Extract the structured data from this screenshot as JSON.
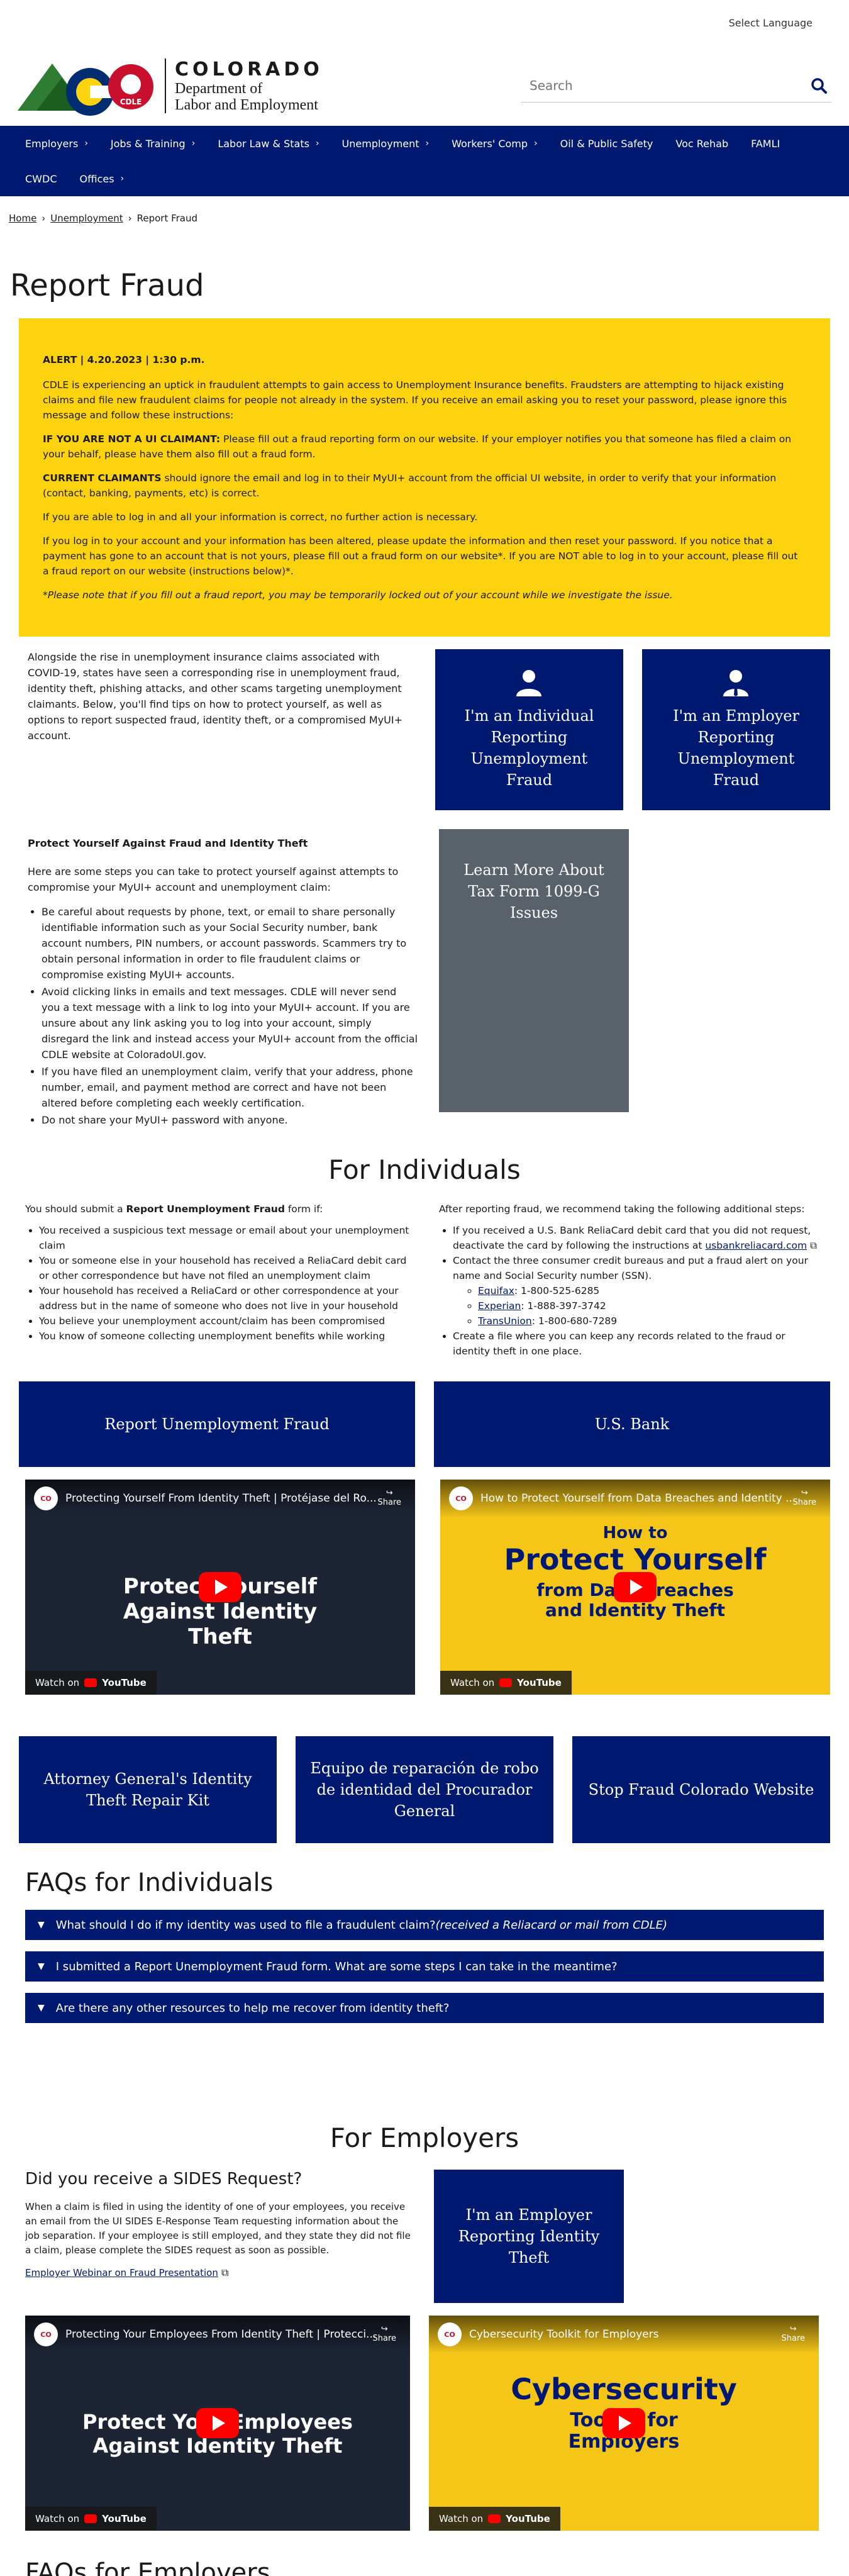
{
  "header": {
    "language_label": "Select Language",
    "logo_state": "COLORADO",
    "logo_dept_line1": "Department of",
    "logo_dept_line2": "Labor and Employment",
    "logo_badge": "CDLE",
    "search_placeholder": "Search"
  },
  "nav": [
    {
      "label": "Employers",
      "chevron": true
    },
    {
      "label": "Jobs & Training",
      "chevron": true
    },
    {
      "label": "Labor Law & Stats",
      "chevron": true
    },
    {
      "label": "Unemployment",
      "chevron": true
    },
    {
      "label": "Workers' Comp",
      "chevron": true
    },
    {
      "label": "Oil & Public Safety",
      "chevron": false
    },
    {
      "label": "Voc Rehab",
      "chevron": false
    },
    {
      "label": "FAMLI",
      "chevron": false
    },
    {
      "label": "CWDC",
      "chevron": false
    },
    {
      "label": "Offices",
      "chevron": true
    }
  ],
  "breadcrumb": {
    "home": "Home",
    "sep": "›",
    "unemployment": "Unemployment",
    "current": "Report Fraud"
  },
  "page_title": "Report Fraud",
  "alert": {
    "heading": "ALERT | 4.20.2023 | 1:30 p.m.",
    "p1": "CDLE is experiencing an uptick in fraudulent attempts to gain access to Unemployment Insurance benefits. Fraudsters are attempting to hijack existing claims and file new fraudulent claims for people not already in the system. If you receive an email asking you to reset your password, please ignore this message and follow these instructions:",
    "p2_bold": "IF YOU ARE NOT A UI CLAIMANT:",
    "p2_rest": " Please fill out a fraud reporting form on our website. If your employer notifies you that someone has filed a claim on your behalf, please have them also fill out a fraud form.",
    "p3_bold": "CURRENT CLAIMANTS",
    "p3_rest": " should ignore the email and log in to their MyUI+ account from the official UI website, in order to verify that your information (contact, banking, payments, etc) is correct.",
    "p4": "If you are able to log in and all your information is correct, no further action is necessary.",
    "p5": "If you log in to your account and your information has been altered, please update the information and then reset your password. If you notice that a payment has gone to an account that is not yours, please fill out a fraud form on our website*. If you are NOT able to log in to your account, please fill out a fraud report on our website (instructions below)*.",
    "p6": "*Please note that if you fill out a fraud report, you may be temporarily locked out of your account while we investigate the issue."
  },
  "intro": {
    "text": "Alongside the rise in unemployment insurance claims associated with COVID-19, states have seen a corresponding rise in unemployment fraud, identity theft, phishing attacks, and other scams targeting unemployment claimants. Below, you'll find tips on how to protect yourself, as well as options to report suspected fraud, identity theft, or a compromised MyUI+ account.",
    "card_individual": "I'm an Individual Reporting Unemployment Fraud",
    "card_employer": "I'm an Employer Reporting Unemployment Fraud",
    "card_tax": "Learn More About Tax Form 1099-G Issues"
  },
  "protect": {
    "title": "Protect Yourself Against Fraud and Identity Theft",
    "intro": "Here are some steps you can take to protect yourself against attempts to compromise your MyUI+ account and unemployment claim:",
    "items": [
      "Be careful about requests by phone, text, or email to share personally identifiable information such as your Social Security number, bank account numbers, PIN numbers, or account passwords. Scammers try to obtain personal information in order to file fraudulent claims or compromise existing MyUI+ accounts.",
      "Avoid clicking links in emails and text messages. CDLE will never send you a text message with a link to log into your MyUI+ account. If you are unsure about any link asking you to log into your account, simply disregard the link and instead access your MyUI+ account from the official CDLE website at ColoradoUI.gov.",
      "If you have filed an unemployment claim, verify that your address, phone number, email, and payment method are correct and have not been altered before completing each weekly certification.",
      "Do not share your MyUI+ password with anyone."
    ]
  },
  "individuals": {
    "title": "For Individuals",
    "left_intro_pre": "You should submit a ",
    "left_intro_bold": "Report Unemployment Fraud",
    "left_intro_post": " form if:",
    "left_items": [
      "You received a suspicious text message or email about your unemployment claim",
      "You or someone else in your household has received a ReliaCard debit card or other correspondence but have not filed an unemployment claim",
      "Your household has received a ReliaCard or other correspondence at your address but in the name of someone who does not live in your household",
      "You believe your unemployment account/claim has been compromised",
      "You know of someone collecting unemployment benefits while working"
    ],
    "right_intro": "After reporting fraud, we recommend taking the following additional steps:",
    "right_item1": "If you received a U.S. Bank ReliaCard debit card that you did not request, deactivate the card by following the instructions at ",
    "right_item1_link": "usbankreliacard.com",
    "right_item2": "Contact the three consumer credit bureaus and put a fraud alert on your name and Social Security number (SSN).",
    "bureaus": [
      {
        "name": "Equifax",
        "phone": ": 1-800-525-6285"
      },
      {
        "name": "Experian",
        "phone": ": 1-888-397-3742"
      },
      {
        "name": "TransUnion",
        "phone": ": 1-800-680-7289"
      }
    ],
    "right_item3": "Create a file where you can keep any records related to the fraud or identity theft in one place.",
    "btn_report": "Report Unemployment Fraud",
    "btn_usbank": "U.S. Bank",
    "video1_title": "Protecting Yourself From Identity Theft | Protéjase del Ro...",
    "video1_big": "Protect Yourself Against Identity Theft",
    "video2_title": "How to Protect Yourself from Data Breaches and Identity ...",
    "video2_big1": "How to",
    "video2_big2": "Protect Yourself",
    "video2_big3": "from Data Breaches and Identity Theft",
    "share": "Share",
    "watch_on": "Watch on",
    "youtube": "YouTube",
    "btn_ag": "Attorney General's Identity Theft Repair Kit",
    "btn_equipo": "Equipo de reparación de robo de identidad del Procurador General",
    "btn_stop": "Stop Fraud Colorado Website"
  },
  "faq_individuals": {
    "title": "FAQs for Individuals",
    "items": [
      {
        "q": "What should I do if my identity was used to file a fraudulent claim?",
        "q_em": " (received a Reliacard or mail from CDLE)"
      },
      {
        "q": "I submitted a Report Unemployment Fraud form. What are some steps I can take in the meantime?",
        "q_em": ""
      },
      {
        "q": "Are there any other resources to help me recover from identity theft?",
        "q_em": ""
      }
    ]
  },
  "employers": {
    "title": "For Employers",
    "sides_title": "Did you receive a SIDES Request?",
    "sides_text": "When a claim is filed in using the identity of one of your employees, you receive an email from the UI SIDES E-Response Team requesting information about the job separation. If your employee is still employed, and they state they did not file a claim, please complete the SIDES request as soon as possible.",
    "webinar_link": "Employer Webinar on Fraud Presentation",
    "card_employer": "I'm an Employer Reporting Identity Theft",
    "video3_title": "Protecting Your Employees From Identity Theft | Protecci...",
    "video3_big": "Protect Your Employees Against Identity Theft",
    "video4_title": "Cybersecurity Toolkit for Employers",
    "video4_big1": "Cybersecurity",
    "video4_big2": "Toolkit for Employers",
    "faq_title": "FAQs for Employers"
  }
}
